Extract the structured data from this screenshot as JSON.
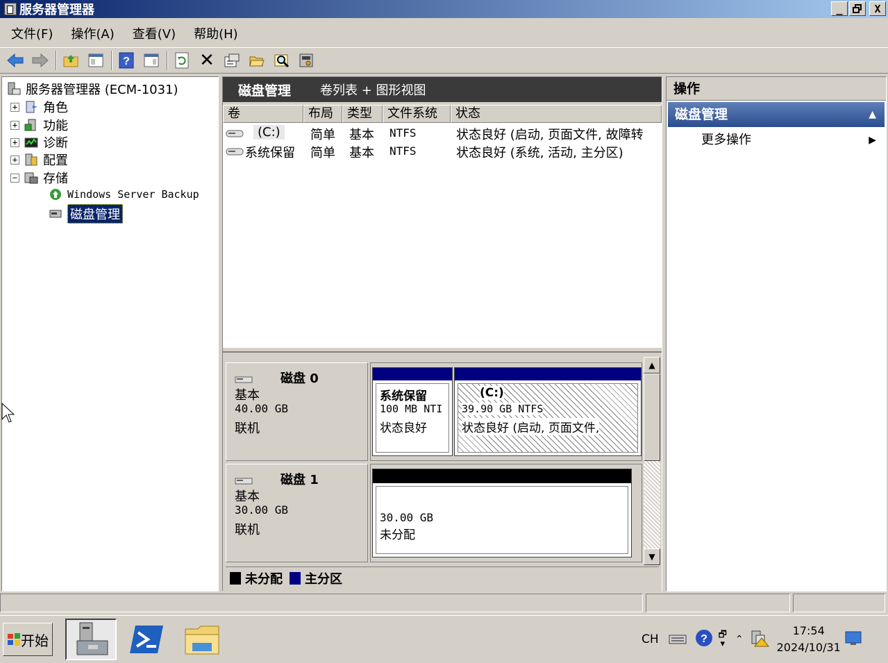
{
  "window": {
    "title": "服务器管理器",
    "controls": {
      "minimize": "_",
      "maximize": "🗗",
      "close": "X"
    }
  },
  "menu": [
    "文件(F)",
    "操作(A)",
    "查看(V)",
    "帮助(H)"
  ],
  "tree": {
    "root": "服务器管理器 (ECM-1031)",
    "items": [
      {
        "label": "角色",
        "expander": "+"
      },
      {
        "label": "功能",
        "expander": "+"
      },
      {
        "label": "诊断",
        "expander": "+"
      },
      {
        "label": "配置",
        "expander": "+"
      },
      {
        "label": "存储",
        "expander": "−"
      }
    ],
    "children": [
      "Windows Server Backup",
      "磁盘管理"
    ]
  },
  "middle": {
    "title": "磁盘管理",
    "view": "卷列表 + 图形视图",
    "columns": [
      "卷",
      "布局",
      "类型",
      "文件系统",
      "状态"
    ],
    "rows": [
      {
        "vol": "(C:)",
        "layout": "简单",
        "type": "基本",
        "fs": "NTFS",
        "status": "状态良好 (启动, 页面文件, 故障转"
      },
      {
        "vol": "系统保留",
        "layout": "简单",
        "type": "基本",
        "fs": "NTFS",
        "status": "状态良好 (系统, 活动, 主分区)"
      }
    ],
    "disks": [
      {
        "name": "磁盘 0",
        "kind": "基本",
        "size": "40.00 GB",
        "state": "联机",
        "partitions": [
          {
            "name": "系统保留",
            "size": "100 MB NTI",
            "status": "状态良好"
          },
          {
            "name": "(C:)",
            "size": "39.90 GB NTFS",
            "status": "状态良好 (启动, 页面文件,"
          }
        ]
      },
      {
        "name": "磁盘 1",
        "kind": "基本",
        "size": "30.00 GB",
        "state": "联机",
        "partitions": [
          {
            "size": "30.00 GB",
            "status": "未分配"
          }
        ]
      }
    ],
    "legend": [
      {
        "label": "未分配",
        "color": "#000000"
      },
      {
        "label": "主分区",
        "color": "#000080"
      }
    ]
  },
  "actions": {
    "header": "操作",
    "section": "磁盘管理",
    "item": "更多操作"
  },
  "taskbar": {
    "start": "开始",
    "lang": "CH",
    "time": "17:54",
    "date": "2024/10/31"
  },
  "colors": {
    "title_gradient_start": "#0a246a",
    "primary_partition": "#000080",
    "unallocated": "#000000"
  }
}
